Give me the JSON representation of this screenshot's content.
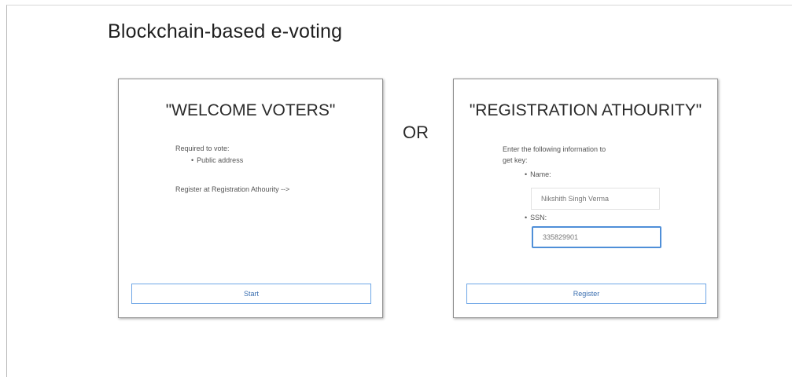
{
  "app": {
    "title": "Blockchain-based e-voting"
  },
  "separator": {
    "label": "OR"
  },
  "voter_card": {
    "title": "\"WELCOME VOTERS\"",
    "required_label": "Required to vote:",
    "required_items": [
      "Public address"
    ],
    "register_hint": "Register at Registration Athourity -->",
    "start_button_label": "Start"
  },
  "registration_card": {
    "title": "\"REGISTRATION ATHOURITY\"",
    "instructions_line1": "Enter the following information to",
    "instructions_line2": "get key:",
    "name_label": "Name:",
    "name_value": "Nikshith Singh Verma",
    "ssn_label": "SSN:",
    "ssn_value": "335829901",
    "register_button_label": "Register"
  },
  "colors": {
    "button_border": "#6ea6e6",
    "button_text": "#3b6fb0",
    "focused_input_border": "#4f8fd8",
    "card_border": "#8f8f8f"
  }
}
